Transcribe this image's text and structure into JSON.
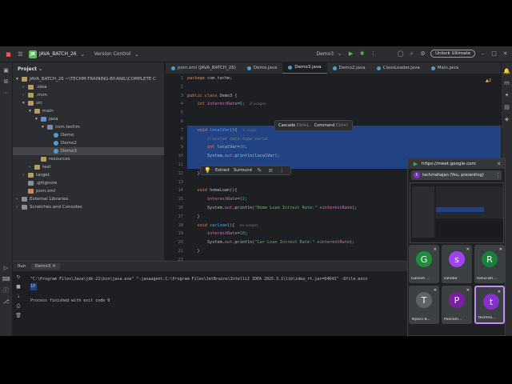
{
  "titlebar": {
    "project_badge": "JB",
    "project_name": "JAVA_BATCH_26",
    "vcs": "Version Control",
    "run_config": "Demo3",
    "unlock": "Unlock Ultimate"
  },
  "project_panel": {
    "title": "Project",
    "items": [
      {
        "label": "JAVA_BATCH_26  ~\\TECHM-TRAINING-BY-ANIL\\COMPLETE C",
        "indent": 0,
        "kind": "folder",
        "arrow": "▾"
      },
      {
        "label": ".idea",
        "indent": 1,
        "kind": "folder",
        "arrow": "›"
      },
      {
        "label": ".mvn",
        "indent": 1,
        "kind": "folder",
        "arrow": "›"
      },
      {
        "label": "src",
        "indent": 1,
        "kind": "folder",
        "arrow": "▾"
      },
      {
        "label": "main",
        "indent": 2,
        "kind": "folder",
        "arrow": "▾"
      },
      {
        "label": "java",
        "indent": 3,
        "kind": "srcf",
        "arrow": "▾"
      },
      {
        "label": "com.techm",
        "indent": 4,
        "kind": "pkg",
        "arrow": "▾"
      },
      {
        "label": "Demo",
        "indent": 5,
        "kind": "jfile",
        "arrow": ""
      },
      {
        "label": "Demo2",
        "indent": 5,
        "kind": "jfile",
        "arrow": ""
      },
      {
        "label": "Demo3",
        "indent": 5,
        "kind": "jfile",
        "arrow": "",
        "selected": true
      },
      {
        "label": "resources",
        "indent": 3,
        "kind": "folder",
        "arrow": ""
      },
      {
        "label": "test",
        "indent": 2,
        "kind": "folder",
        "arrow": "›"
      },
      {
        "label": "target",
        "indent": 1,
        "kind": "folder",
        "arrow": "›"
      },
      {
        "label": ".gitignore",
        "indent": 1,
        "kind": "lib",
        "arrow": ""
      },
      {
        "label": "pom.xml",
        "indent": 1,
        "kind": "xmlf",
        "arrow": ""
      },
      {
        "label": "External Libraries",
        "indent": 0,
        "kind": "lib",
        "arrow": "›"
      },
      {
        "label": "Scratches and Consoles",
        "indent": 0,
        "kind": "lib",
        "arrow": "›"
      }
    ]
  },
  "tabs": [
    {
      "label": "pom.xml (JAVA_BATCH_26)",
      "active": false
    },
    {
      "label": "Demo.java",
      "active": false
    },
    {
      "label": "Demo3.java",
      "active": true
    },
    {
      "label": "Demo2.java",
      "active": false
    },
    {
      "label": "ClassLoader.java",
      "active": false
    },
    {
      "label": "Main.java",
      "active": false
    }
  ],
  "editor": {
    "warnings": "▲2",
    "lines": [
      "1",
      "2",
      "3",
      "4",
      "5",
      "6",
      "7",
      "8",
      "9",
      "10",
      "11",
      "12",
      "13",
      "14",
      "15",
      "16",
      "17",
      "18",
      "19",
      "20",
      "21",
      "22"
    ],
    "hints": {
      "usages4": "4 usages",
      "usage1": "1 usage",
      "usages0": "no usages"
    }
  },
  "popup": {
    "opt1": "Cascade",
    "key1": "Ctrl+L",
    "opt2": "Command",
    "key2": "Ctrl+I"
  },
  "floatbar": {
    "extract": "Extract",
    "surround": "Surround"
  },
  "run": {
    "tab": "Run",
    "config": "Demo3",
    "lines": [
      "\"C:\\Program Files\\Java\\jdk-21\\bin\\java.exe\" \"-javaagent:C:\\Program Files\\JetBrains\\IntelliJ IDEA 2025.3.1\\lib\\idea_rt.jar=64643\" -Dfile.enco",
      "10",
      "",
      "Process finished with exit code 0"
    ]
  },
  "meet": {
    "url": "https://meet.google.com",
    "presenter_initial": "t",
    "presenter": "techmahajan (You, presenting)",
    "tiles": [
      {
        "initial": "G",
        "name": "Ganesh ...",
        "color": "#1e8e3e"
      },
      {
        "initial": "s",
        "name": "saheba",
        "color": "#a142f4"
      },
      {
        "initial": "R",
        "name": "Rahul Bh...",
        "color": "#188038"
      },
      {
        "initial": "T",
        "name": "Tejasvi B...",
        "color": "#5f6368"
      },
      {
        "initial": "P",
        "name": "Poonam...",
        "color": "#7b1fa2"
      },
      {
        "initial": "t",
        "name": "techma...",
        "color": "#8430ce",
        "speaking": true
      }
    ]
  }
}
